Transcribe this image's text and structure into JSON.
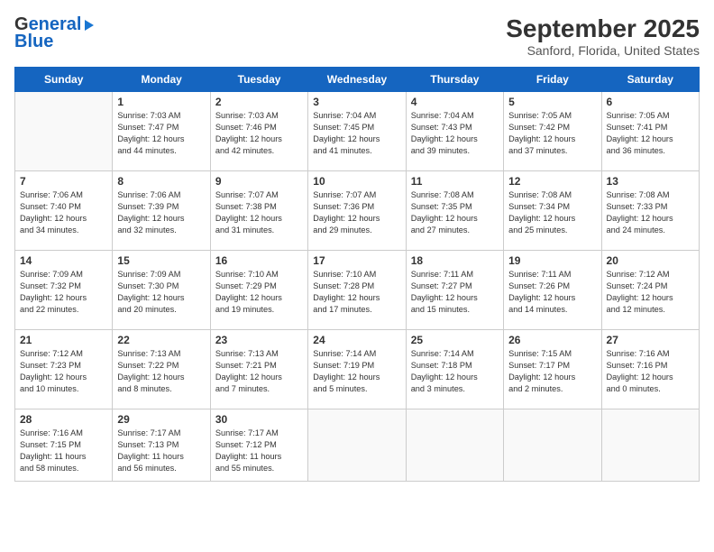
{
  "header": {
    "logo_line1_text": "General",
    "logo_line2_text": "Blue",
    "title": "September 2025",
    "subtitle": "Sanford, Florida, United States"
  },
  "calendar": {
    "weekdays": [
      "Sunday",
      "Monday",
      "Tuesday",
      "Wednesday",
      "Thursday",
      "Friday",
      "Saturday"
    ],
    "weeks": [
      [
        {
          "day": "",
          "info": ""
        },
        {
          "day": "1",
          "info": "Sunrise: 7:03 AM\nSunset: 7:47 PM\nDaylight: 12 hours\nand 44 minutes."
        },
        {
          "day": "2",
          "info": "Sunrise: 7:03 AM\nSunset: 7:46 PM\nDaylight: 12 hours\nand 42 minutes."
        },
        {
          "day": "3",
          "info": "Sunrise: 7:04 AM\nSunset: 7:45 PM\nDaylight: 12 hours\nand 41 minutes."
        },
        {
          "day": "4",
          "info": "Sunrise: 7:04 AM\nSunset: 7:43 PM\nDaylight: 12 hours\nand 39 minutes."
        },
        {
          "day": "5",
          "info": "Sunrise: 7:05 AM\nSunset: 7:42 PM\nDaylight: 12 hours\nand 37 minutes."
        },
        {
          "day": "6",
          "info": "Sunrise: 7:05 AM\nSunset: 7:41 PM\nDaylight: 12 hours\nand 36 minutes."
        }
      ],
      [
        {
          "day": "7",
          "info": "Sunrise: 7:06 AM\nSunset: 7:40 PM\nDaylight: 12 hours\nand 34 minutes."
        },
        {
          "day": "8",
          "info": "Sunrise: 7:06 AM\nSunset: 7:39 PM\nDaylight: 12 hours\nand 32 minutes."
        },
        {
          "day": "9",
          "info": "Sunrise: 7:07 AM\nSunset: 7:38 PM\nDaylight: 12 hours\nand 31 minutes."
        },
        {
          "day": "10",
          "info": "Sunrise: 7:07 AM\nSunset: 7:36 PM\nDaylight: 12 hours\nand 29 minutes."
        },
        {
          "day": "11",
          "info": "Sunrise: 7:08 AM\nSunset: 7:35 PM\nDaylight: 12 hours\nand 27 minutes."
        },
        {
          "day": "12",
          "info": "Sunrise: 7:08 AM\nSunset: 7:34 PM\nDaylight: 12 hours\nand 25 minutes."
        },
        {
          "day": "13",
          "info": "Sunrise: 7:08 AM\nSunset: 7:33 PM\nDaylight: 12 hours\nand 24 minutes."
        }
      ],
      [
        {
          "day": "14",
          "info": "Sunrise: 7:09 AM\nSunset: 7:32 PM\nDaylight: 12 hours\nand 22 minutes."
        },
        {
          "day": "15",
          "info": "Sunrise: 7:09 AM\nSunset: 7:30 PM\nDaylight: 12 hours\nand 20 minutes."
        },
        {
          "day": "16",
          "info": "Sunrise: 7:10 AM\nSunset: 7:29 PM\nDaylight: 12 hours\nand 19 minutes."
        },
        {
          "day": "17",
          "info": "Sunrise: 7:10 AM\nSunset: 7:28 PM\nDaylight: 12 hours\nand 17 minutes."
        },
        {
          "day": "18",
          "info": "Sunrise: 7:11 AM\nSunset: 7:27 PM\nDaylight: 12 hours\nand 15 minutes."
        },
        {
          "day": "19",
          "info": "Sunrise: 7:11 AM\nSunset: 7:26 PM\nDaylight: 12 hours\nand 14 minutes."
        },
        {
          "day": "20",
          "info": "Sunrise: 7:12 AM\nSunset: 7:24 PM\nDaylight: 12 hours\nand 12 minutes."
        }
      ],
      [
        {
          "day": "21",
          "info": "Sunrise: 7:12 AM\nSunset: 7:23 PM\nDaylight: 12 hours\nand 10 minutes."
        },
        {
          "day": "22",
          "info": "Sunrise: 7:13 AM\nSunset: 7:22 PM\nDaylight: 12 hours\nand 8 minutes."
        },
        {
          "day": "23",
          "info": "Sunrise: 7:13 AM\nSunset: 7:21 PM\nDaylight: 12 hours\nand 7 minutes."
        },
        {
          "day": "24",
          "info": "Sunrise: 7:14 AM\nSunset: 7:19 PM\nDaylight: 12 hours\nand 5 minutes."
        },
        {
          "day": "25",
          "info": "Sunrise: 7:14 AM\nSunset: 7:18 PM\nDaylight: 12 hours\nand 3 minutes."
        },
        {
          "day": "26",
          "info": "Sunrise: 7:15 AM\nSunset: 7:17 PM\nDaylight: 12 hours\nand 2 minutes."
        },
        {
          "day": "27",
          "info": "Sunrise: 7:16 AM\nSunset: 7:16 PM\nDaylight: 12 hours\nand 0 minutes."
        }
      ],
      [
        {
          "day": "28",
          "info": "Sunrise: 7:16 AM\nSunset: 7:15 PM\nDaylight: 11 hours\nand 58 minutes."
        },
        {
          "day": "29",
          "info": "Sunrise: 7:17 AM\nSunset: 7:13 PM\nDaylight: 11 hours\nand 56 minutes."
        },
        {
          "day": "30",
          "info": "Sunrise: 7:17 AM\nSunset: 7:12 PM\nDaylight: 11 hours\nand 55 minutes."
        },
        {
          "day": "",
          "info": ""
        },
        {
          "day": "",
          "info": ""
        },
        {
          "day": "",
          "info": ""
        },
        {
          "day": "",
          "info": ""
        }
      ]
    ]
  }
}
